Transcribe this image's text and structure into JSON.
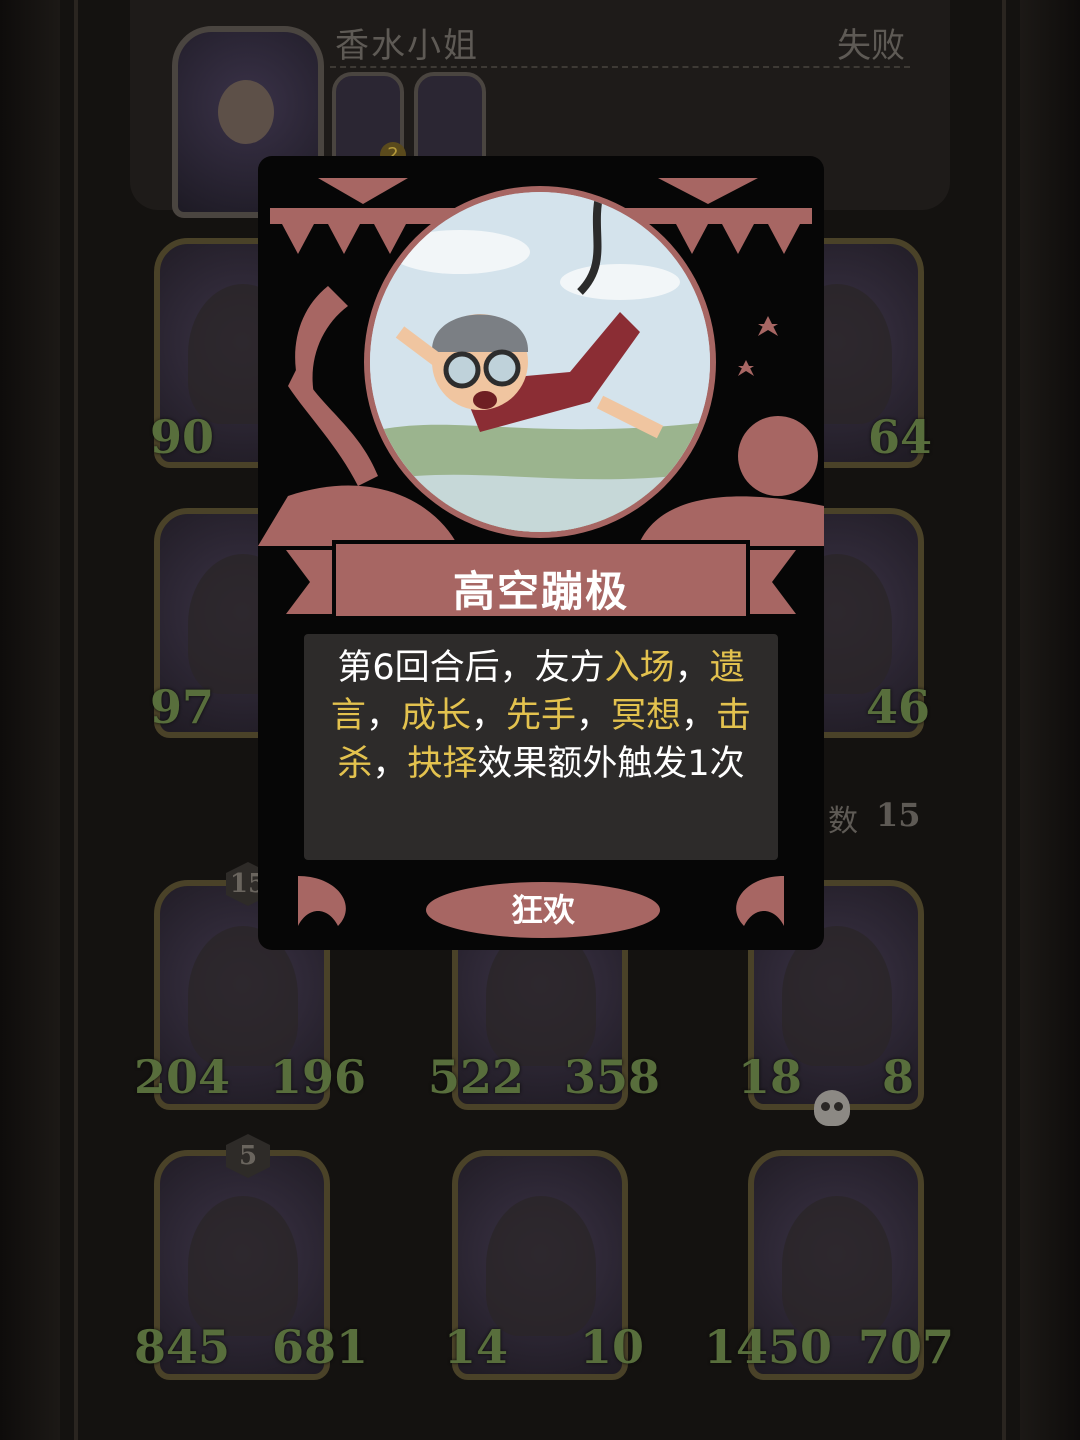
{
  "header": {
    "player_name": "香水小姐",
    "result": "失败",
    "mini_badge": "2"
  },
  "board": {
    "units": [
      {
        "attack": "90",
        "health": ""
      },
      {
        "attack": "",
        "health": "64"
      },
      {
        "attack": "97",
        "health": ""
      },
      {
        "attack": "",
        "health": "46"
      },
      {
        "tier": "15",
        "attack": "204",
        "health": "196"
      },
      {
        "attack": "522",
        "health": "358"
      },
      {
        "attack": "18",
        "health": "8"
      },
      {
        "tier": "5",
        "attack": "845",
        "health": "681"
      },
      {
        "attack": "14",
        "health": "10"
      },
      {
        "attack": "1450",
        "health": "707"
      }
    ],
    "count_label": "数",
    "count_value": "15"
  },
  "card": {
    "title": "高空蹦极",
    "desc_parts": {
      "p1": "第6回合后，友方",
      "k1": "入场",
      "p2": "，",
      "k2": "遗言",
      "p3": "，",
      "k3": "成长",
      "p4": "，",
      "k4": "先手",
      "p5": "，",
      "k5": "冥想",
      "p6": "，",
      "k6": "击杀",
      "p7": "，",
      "k7": "抉择",
      "p8": "效果额外触发1次"
    },
    "tag": "狂欢",
    "colors": {
      "accent": "#a76663",
      "keyword": "#e3c24e"
    }
  }
}
